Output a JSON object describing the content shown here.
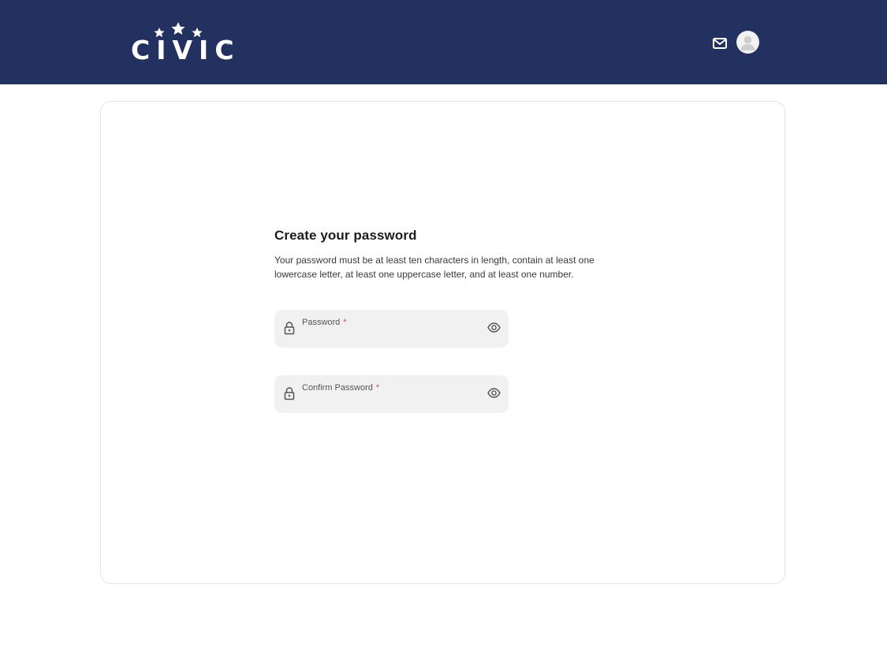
{
  "header": {
    "logo_text": "CIVIC",
    "brand_color": "#22315f",
    "mail_icon": "mail-icon",
    "avatar_icon": "user-avatar-icon"
  },
  "form": {
    "title": "Create your password",
    "description": "Your password must be at least ten characters in length, contain at least one lowercase letter, at least one uppercase letter, and at least one number.",
    "fields": [
      {
        "label": "Password",
        "required_mark": "*",
        "value": "",
        "icon": "lock-icon",
        "toggle_icon": "eye-icon"
      },
      {
        "label": "Confirm Password",
        "required_mark": "*",
        "value": "",
        "icon": "lock-icon",
        "toggle_icon": "eye-icon"
      }
    ]
  }
}
